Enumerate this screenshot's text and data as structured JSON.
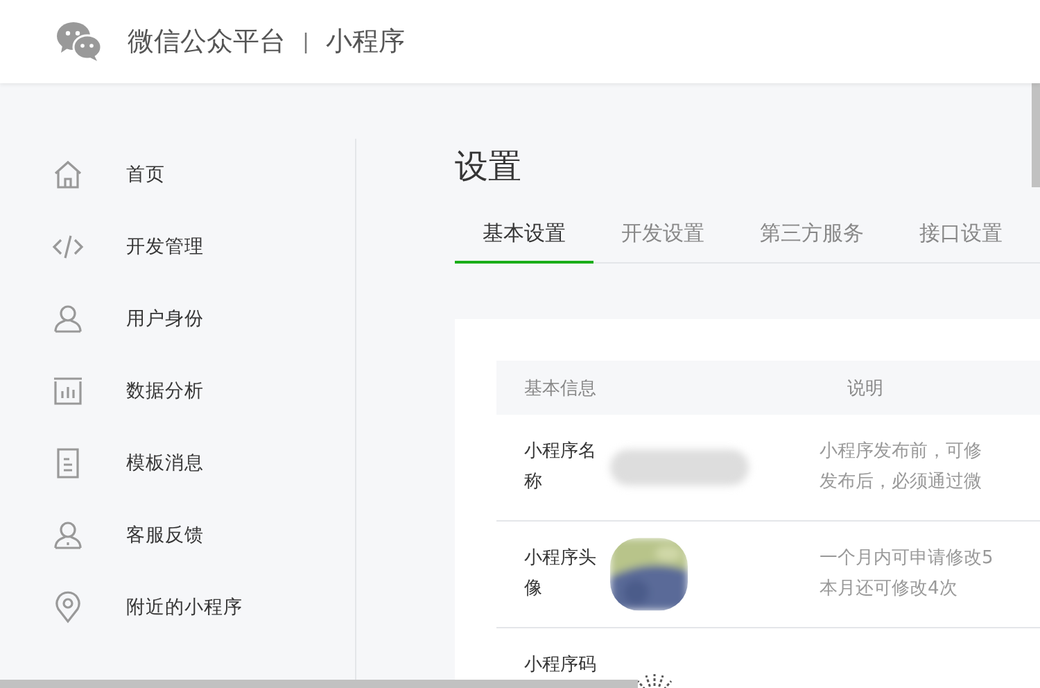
{
  "header": {
    "brand": "微信公众平台",
    "separator": "|",
    "product": "小程序"
  },
  "sidebar": {
    "items": [
      {
        "kind": "home",
        "label": "首页",
        "selected": false
      },
      {
        "kind": "code",
        "label": "开发管理",
        "selected": false
      },
      {
        "kind": "user",
        "label": "用户身份",
        "selected": false
      },
      {
        "kind": "chart",
        "label": "数据分析",
        "selected": false
      },
      {
        "kind": "doc",
        "label": "模板消息",
        "selected": false
      },
      {
        "kind": "service",
        "label": "客服反馈",
        "selected": false
      },
      {
        "kind": "pin",
        "label": "附近的小程序",
        "selected": false
      }
    ]
  },
  "page_title": "设置",
  "tabs": [
    {
      "label": "基本设置",
      "selected": true
    },
    {
      "label": "开发设置",
      "selected": false
    },
    {
      "label": "第三方服务",
      "selected": false
    },
    {
      "label": "接口设置",
      "selected": false
    }
  ],
  "table": {
    "columns": [
      "基本信息",
      "说明"
    ],
    "rows": [
      {
        "label": "小程序名称",
        "kind": "blurred",
        "description": [
          "小程序发布前，可修",
          "发布后，必须通过微"
        ]
      },
      {
        "label": "小程序头像",
        "kind": "avatar",
        "description": [
          "一个月内可申请修改5",
          "本月还可修改4次"
        ]
      },
      {
        "label": "小程序码",
        "kind": "qr",
        "description": []
      }
    ]
  }
}
